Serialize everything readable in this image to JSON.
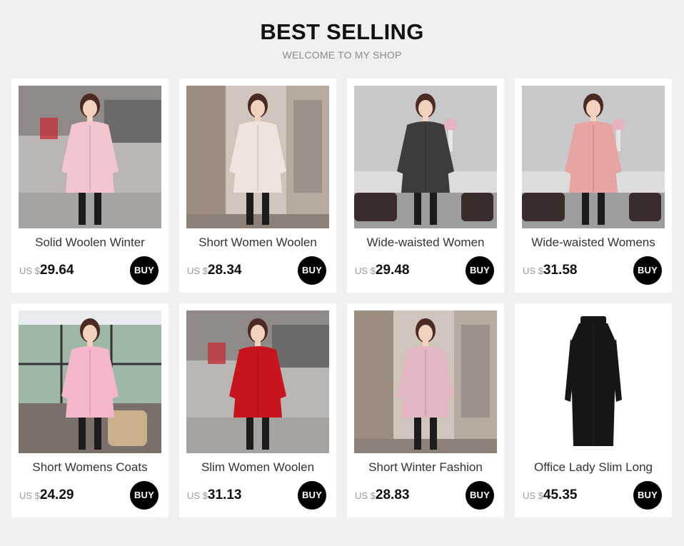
{
  "header": {
    "title": "BEST SELLING",
    "subtitle": "WELCOME TO MY SHOP"
  },
  "buy_label": "BUY",
  "products": [
    {
      "name": "Solid Woolen Winter",
      "currency": "US $",
      "price": "29.64",
      "coat_color": "#f3c5cf",
      "scene": "street"
    },
    {
      "name": "Short Women Woolen",
      "currency": "US $",
      "price": "28.34",
      "coat_color": "#efe3df",
      "scene": "shop"
    },
    {
      "name": "Wide-waisted Women",
      "currency": "US $",
      "price": "29.48",
      "coat_color": "#3c3c3f",
      "scene": "living-room"
    },
    {
      "name": "Wide-waisted Womens",
      "currency": "US $",
      "price": "31.58",
      "coat_color": "#e8a3a3",
      "scene": "living-room"
    },
    {
      "name": "Short Womens Coats",
      "currency": "US $",
      "price": "24.29",
      "coat_color": "#f5b7cc",
      "scene": "window"
    },
    {
      "name": "Slim Women Woolen",
      "currency": "US $",
      "price": "31.13",
      "coat_color": "#c8141c",
      "scene": "street"
    },
    {
      "name": "Short Winter Fashion",
      "currency": "US $",
      "price": "28.83",
      "coat_color": "#e2b7c3",
      "scene": "shop"
    },
    {
      "name": "Office Lady Slim Long",
      "currency": "US $",
      "price": "45.35",
      "coat_color": "#161616",
      "scene": "plain"
    }
  ]
}
